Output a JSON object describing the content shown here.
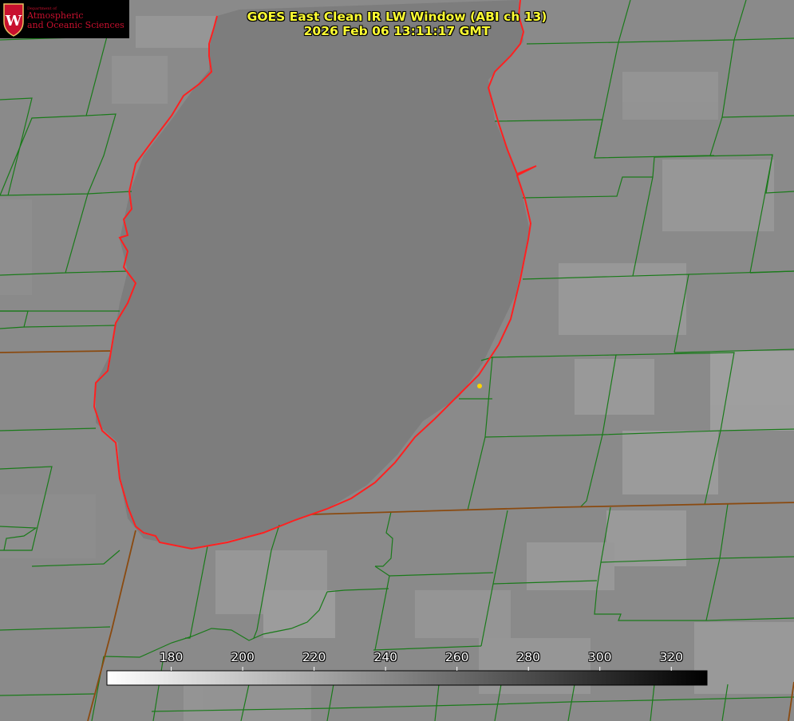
{
  "logo": {
    "dept": "Department of",
    "line1": "Atmospheric",
    "line2": "and Oceanic Sciences",
    "shield_letter": "W"
  },
  "title": {
    "line1": "GOES East Clean IR LW Window (ABI ch 13)",
    "line2": "2026 Feb 06 13:11:17 GMT"
  },
  "colorbar": {
    "min": 162,
    "max": 330,
    "ticks": [
      180,
      200,
      220,
      240,
      260,
      280,
      300,
      320
    ],
    "gradient": [
      "#ffffff",
      "#000000"
    ]
  },
  "colors": {
    "land": "#8a8a8a",
    "lake": "#7d7d7d",
    "county_lines": "#1a7a1a",
    "coastline": "#ff2020",
    "state_lines": "#8a4a10",
    "marker": "#ffd400",
    "title_text": "#ffff33"
  },
  "icons": {
    "logo": "uw-shield-icon",
    "station": "station-dot-icon"
  }
}
